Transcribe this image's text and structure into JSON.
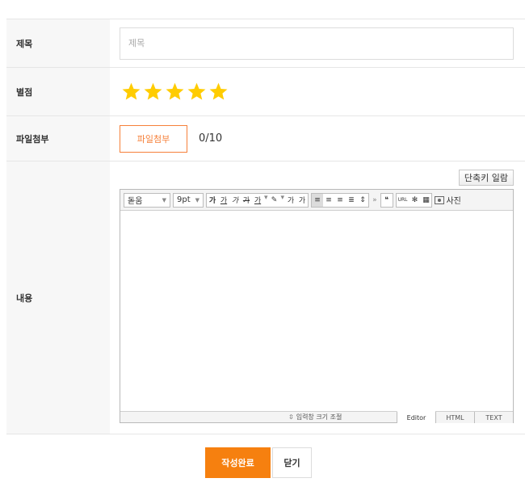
{
  "form": {
    "title": {
      "label": "제목",
      "placeholder": "제목",
      "value": ""
    },
    "rating": {
      "label": "별점",
      "value": 5,
      "max": 5,
      "star_color": "#FFCC00"
    },
    "file": {
      "label": "파일첨부",
      "button": "파일첨부",
      "count": "0/10"
    },
    "content": {
      "label": "내용",
      "shortcut_button": "단축키 일람",
      "toolbar": {
        "font": "돋움",
        "size": "9pt",
        "group1": [
          "가",
          "가",
          "가",
          "가",
          "가"
        ],
        "group2": [
          "가",
          "가"
        ],
        "photo_label": "사진"
      },
      "footer": {
        "resize": "입력창 크기 조절",
        "tabs": [
          "Editor",
          "HTML",
          "TEXT"
        ],
        "active_tab": "Editor"
      }
    }
  },
  "actions": {
    "submit": "작성완료",
    "close": "닫기"
  },
  "colors": {
    "accent": "#F6800F",
    "file_border": "#F6803A"
  }
}
